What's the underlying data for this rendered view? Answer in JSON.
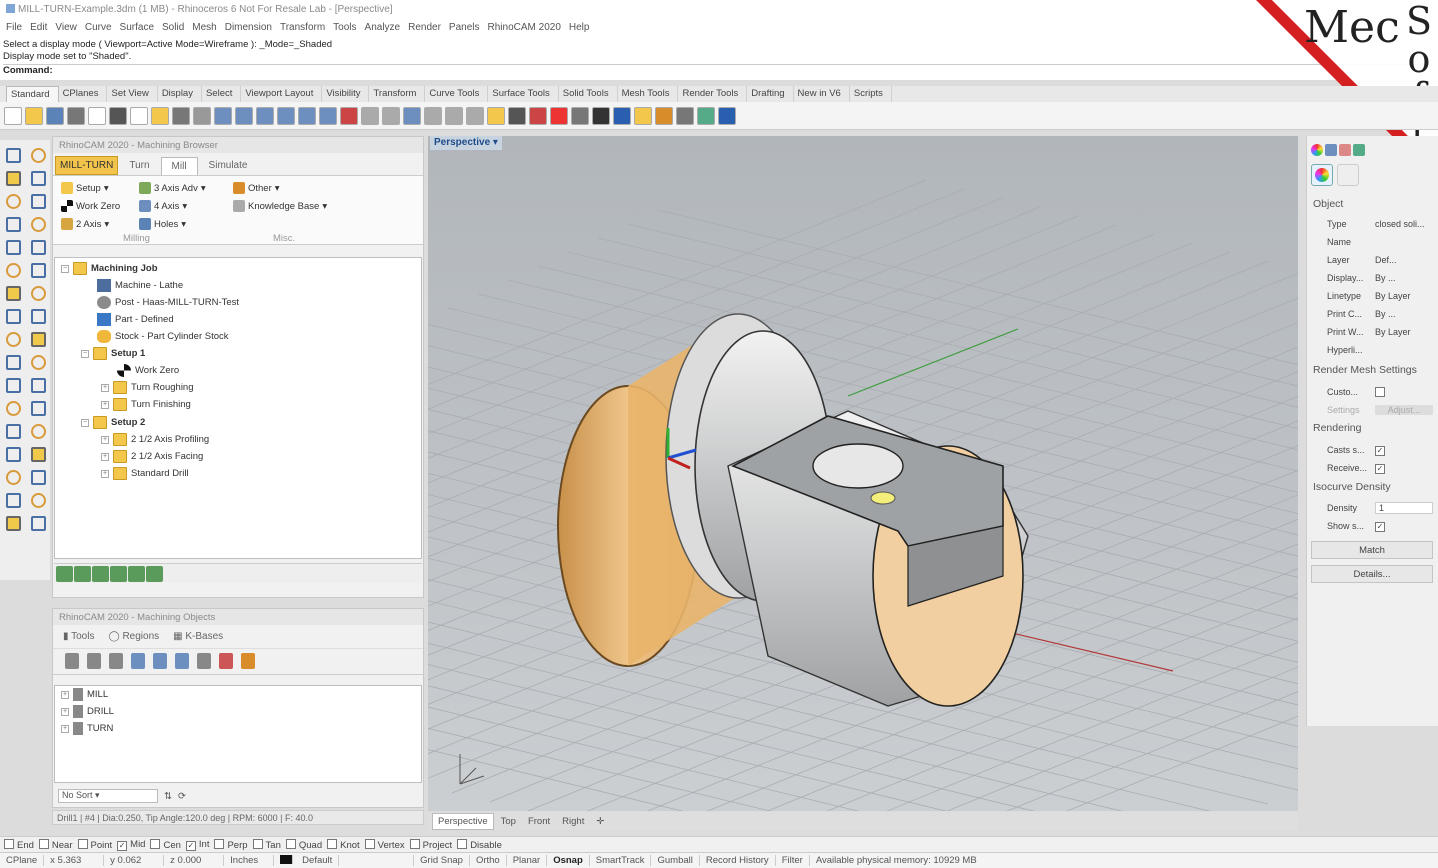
{
  "window": {
    "title": "MILL-TURN-Example.3dm (1 MB) - Rhinoceros 6 Not For Resale Lab - [Perspective]"
  },
  "menu": [
    "File",
    "Edit",
    "View",
    "Curve",
    "Surface",
    "Solid",
    "Mesh",
    "Dimension",
    "Transform",
    "Tools",
    "Analyze",
    "Render",
    "Panels",
    "RhinoCAM 2020",
    "Help"
  ],
  "command": {
    "line1": "Select a display mode ( Viewport=Active  Mode=Wireframe ): _Mode=_Shaded",
    "line2": "Display mode set to \"Shaded\".",
    "prompt": "Command:"
  },
  "logo": {
    "text1": "Mec",
    "text2": "Soft",
    "stripe_color": "#d42020"
  },
  "toolbar_tabs": [
    "Standard",
    "CPlanes",
    "Set View",
    "Display",
    "Select",
    "Viewport Layout",
    "Visibility",
    "Transform",
    "Curve Tools",
    "Surface Tools",
    "Solid Tools",
    "Mesh Tools",
    "Render Tools",
    "Drafting",
    "New in V6",
    "Scripts"
  ],
  "browser": {
    "title": "RhinoCAM 2020 - Machining Browser",
    "tabs": [
      "MILL-TURN",
      "Turn",
      "Mill",
      "Simulate"
    ],
    "ribbon": {
      "setup": "Setup",
      "work_zero": "Work Zero",
      "two_axis": "2 Axis",
      "three_axis": "3 Axis Adv",
      "four_axis": "4 Axis",
      "holes": "Holes",
      "other": "Other",
      "knowledge": "Knowledge Base",
      "group_milling": "Milling",
      "group_misc": "Misc."
    },
    "tree": {
      "root": "Machining Job",
      "machine": "Machine - Lathe",
      "post": "Post - Haas-MILL-TURN-Test",
      "part": "Part - Defined",
      "stock": "Stock - Part Cylinder Stock",
      "setup1": "Setup 1",
      "setup1_work_zero": "Work Zero",
      "turn_roughing": "Turn Roughing",
      "turn_finishing": "Turn Finishing",
      "setup2": "Setup 2",
      "profiling": "2 1/2 Axis Profiling",
      "facing": "2 1/2 Axis Facing",
      "drill": "Standard Drill"
    }
  },
  "objects": {
    "title": "RhinoCAM 2020 - Machining Objects",
    "tabs": [
      "Tools",
      "Regions",
      "K-Bases"
    ],
    "items": [
      "MILL",
      "DRILL",
      "TURN"
    ],
    "sort": "No Sort"
  },
  "tool_status": "Drill1 | #4 | Dia:0.250, Tip Angle:120.0 deg | RPM: 6000 | F: 40.0",
  "viewport": {
    "name": "Perspective",
    "tabs": [
      "Perspective",
      "Top",
      "Front",
      "Right"
    ]
  },
  "properties": {
    "object_header": "Object",
    "rows": [
      {
        "k": "Type",
        "v": "closed soli..."
      },
      {
        "k": "Name",
        "v": ""
      },
      {
        "k": "Layer",
        "v": "Def..."
      },
      {
        "k": "Display...",
        "v": "By ..."
      },
      {
        "k": "Linetype",
        "v": "By Layer"
      },
      {
        "k": "Print C...",
        "v": "By ..."
      },
      {
        "k": "Print W...",
        "v": "By Layer"
      },
      {
        "k": "Hyperli...",
        "v": ""
      }
    ],
    "render_mesh_header": "Render Mesh Settings",
    "custom": "Custo...",
    "settings": "Settings",
    "adjust": "Adjust...",
    "rendering_header": "Rendering",
    "casts": "Casts s...",
    "receive": "Receive...",
    "isocurve_header": "Isocurve Density",
    "density_label": "Density",
    "density_value": "1",
    "show": "Show s...",
    "match": "Match",
    "details": "Details..."
  },
  "osnaps": [
    {
      "l": "End",
      "c": false
    },
    {
      "l": "Near",
      "c": false
    },
    {
      "l": "Point",
      "c": false
    },
    {
      "l": "Mid",
      "c": true
    },
    {
      "l": "Cen",
      "c": false
    },
    {
      "l": "Int",
      "c": true
    },
    {
      "l": "Perp",
      "c": false
    },
    {
      "l": "Tan",
      "c": false
    },
    {
      "l": "Quad",
      "c": false
    },
    {
      "l": "Knot",
      "c": false
    },
    {
      "l": "Vertex",
      "c": false
    },
    {
      "l": "Project",
      "c": false
    },
    {
      "l": "Disable",
      "c": false
    }
  ],
  "status": {
    "cplane": "CPlane",
    "x": "x 5.363",
    "y": "y 0.062",
    "z": "z 0.000",
    "units": "Inches",
    "layer": "Default",
    "grid": "Grid Snap",
    "ortho": "Ortho",
    "planar": "Planar",
    "osnap": "Osnap",
    "smarttrack": "SmartTrack",
    "gumball": "Gumball",
    "history": "Record History",
    "filter": "Filter",
    "memory": "Available physical memory: 10929 MB"
  },
  "colors": {
    "stock": "#e9b46a",
    "face": "#f4d3a4",
    "steel": "#d9dadb",
    "viewport_bg": "#b9bdc1",
    "accent": "#f2c44b"
  }
}
